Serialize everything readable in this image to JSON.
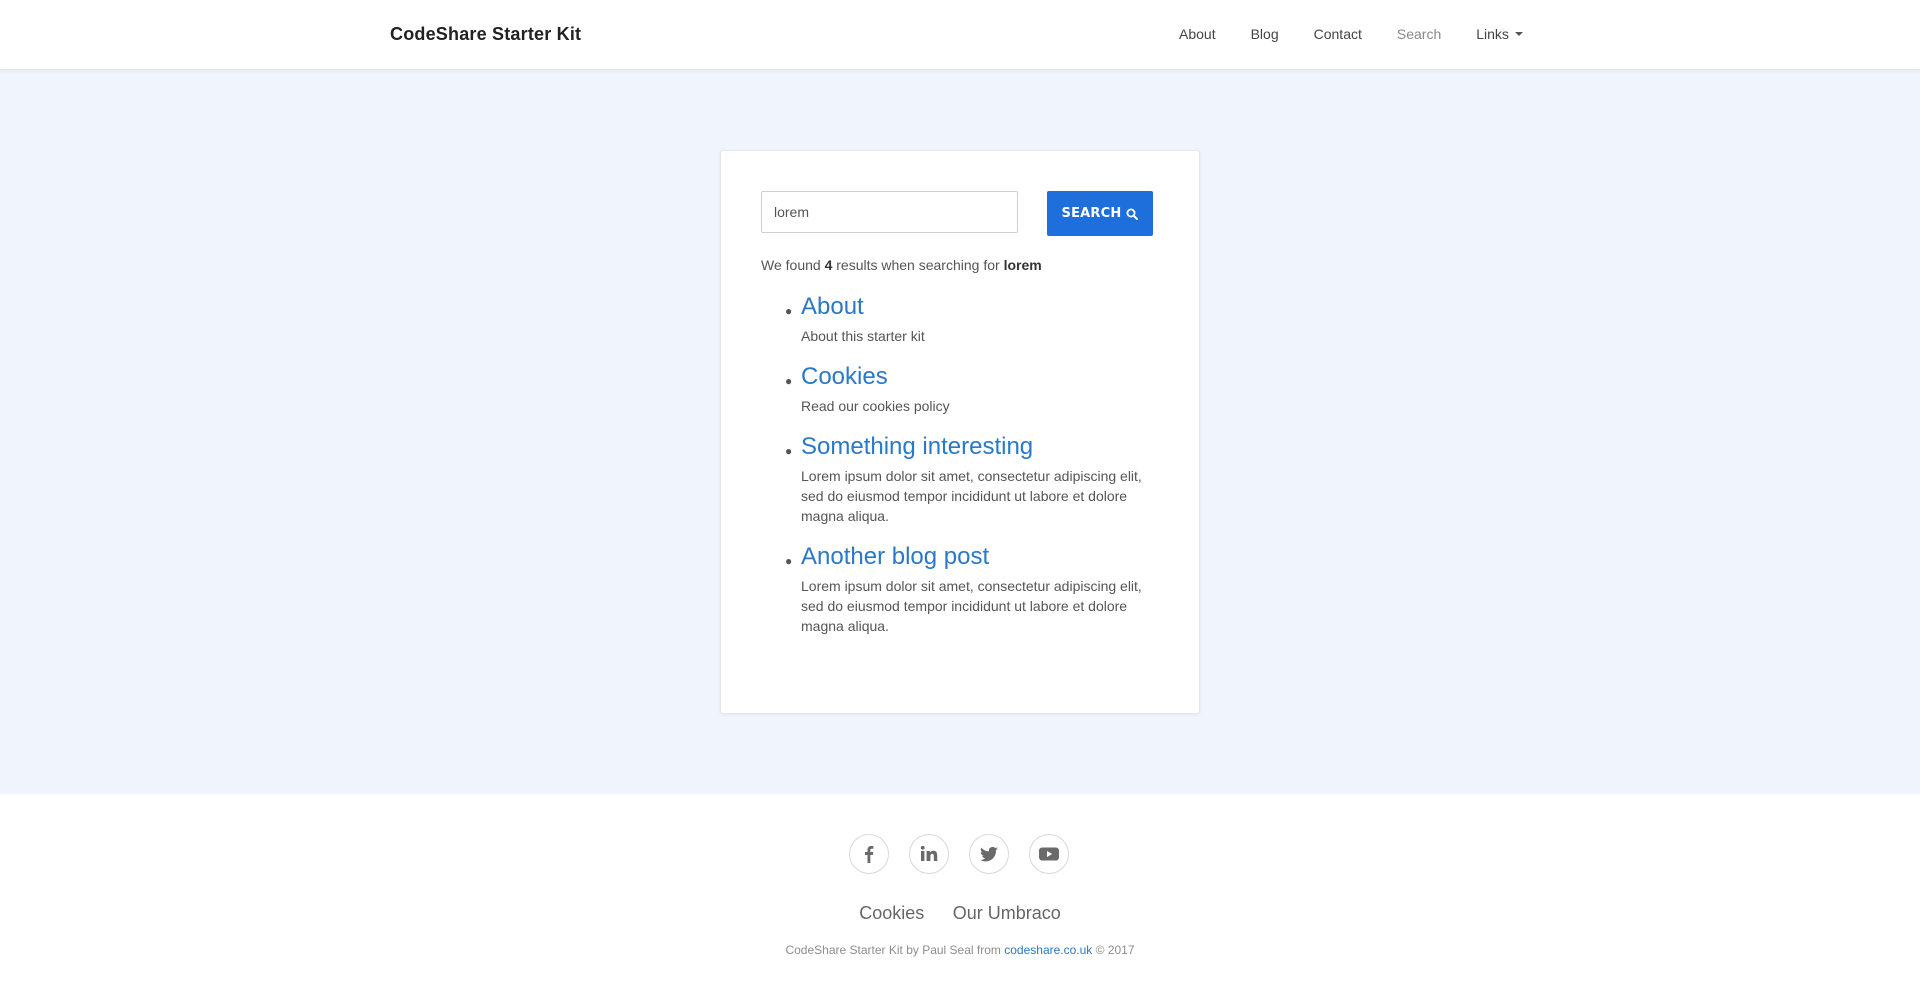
{
  "brand": "CodeShare Starter Kit",
  "nav": {
    "items": [
      {
        "label": "About"
      },
      {
        "label": "Blog"
      },
      {
        "label": "Contact"
      },
      {
        "label": "Search"
      },
      {
        "label": "Links"
      }
    ]
  },
  "search": {
    "value": "lorem",
    "button_label": "SEARCH",
    "button_icon": "search-icon"
  },
  "summary": {
    "prefix": "We found",
    "count": "4",
    "middle": "results when searching for",
    "term": "lorem"
  },
  "results": [
    {
      "title": "About",
      "description": "About this starter kit"
    },
    {
      "title": "Cookies",
      "description": "Read our cookies policy"
    },
    {
      "title": "Something interesting",
      "description": "Lorem ipsum dolor sit amet, consectetur adipiscing elit, sed do eiusmod tempor incididunt ut labore et dolore magna aliqua."
    },
    {
      "title": "Another blog post",
      "description": "Lorem ipsum dolor sit amet, consectetur adipiscing elit, sed do eiusmod tempor incididunt ut labore et dolore magna aliqua."
    }
  ],
  "footer": {
    "social": [
      "facebook-icon",
      "linkedin-icon",
      "twitter-icon",
      "youtube-icon"
    ],
    "links": [
      {
        "label": "Cookies"
      },
      {
        "label": "Our Umbraco"
      }
    ],
    "credit_prefix": "CodeShare Starter Kit by Paul Seal from",
    "credit_link": "codeshare.co.uk",
    "credit_suffix": "© 2017"
  },
  "colors": {
    "accent": "#1e6fdb",
    "link": "#2a78c8",
    "background": "#f0f5fd"
  }
}
